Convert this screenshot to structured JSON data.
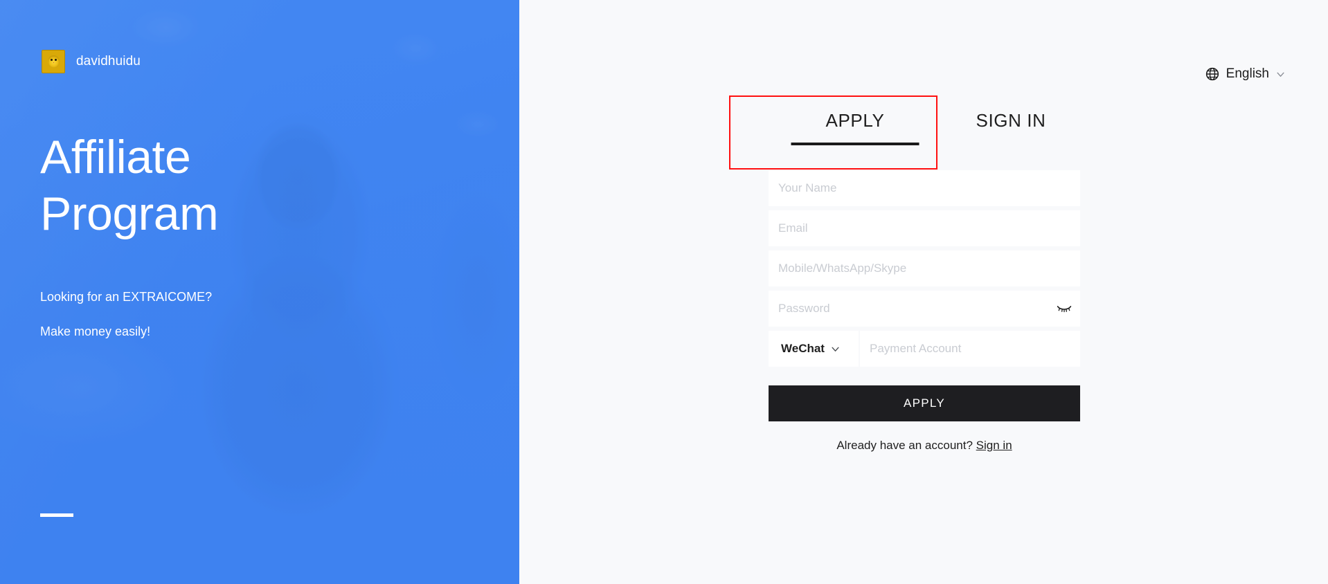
{
  "brand": {
    "name": "davidhuidu",
    "logo_icon": "pikachu-avatar-icon"
  },
  "hero": {
    "title_line1": "Affiliate",
    "title_line2": "Program",
    "subtitle_line1": "Looking for an EXTRAICOME?",
    "subtitle_line2": "Make money easily!"
  },
  "language": {
    "globe_icon": "globe-icon",
    "label": "English",
    "chevron_icon": "chevron-down-icon"
  },
  "tabs": {
    "apply": "APPLY",
    "sign_in": "SIGN IN",
    "active": "APPLY",
    "highlight_color": "#ff0f0f"
  },
  "form": {
    "name_placeholder": "Your Name",
    "name_value": "",
    "email_placeholder": "Email",
    "email_value": "",
    "contact_placeholder": "Mobile/WhatsApp/Skype",
    "contact_value": "",
    "password_placeholder": "Password",
    "password_value": "",
    "password_toggle_icon": "eye-closed-icon",
    "payment_method": "WeChat",
    "payment_method_chevron": "chevron-down-icon",
    "payment_account_placeholder": "Payment Account",
    "payment_account_value": "",
    "submit_label": "APPLY"
  },
  "footer": {
    "prompt": "Already have an account?",
    "link": "Sign in"
  },
  "colors": {
    "brand_blue": "#4285f0",
    "panel_bg": "#f8f9fb",
    "submit_dark": "#1e1e21",
    "accent_red": "#ff0f0f"
  }
}
